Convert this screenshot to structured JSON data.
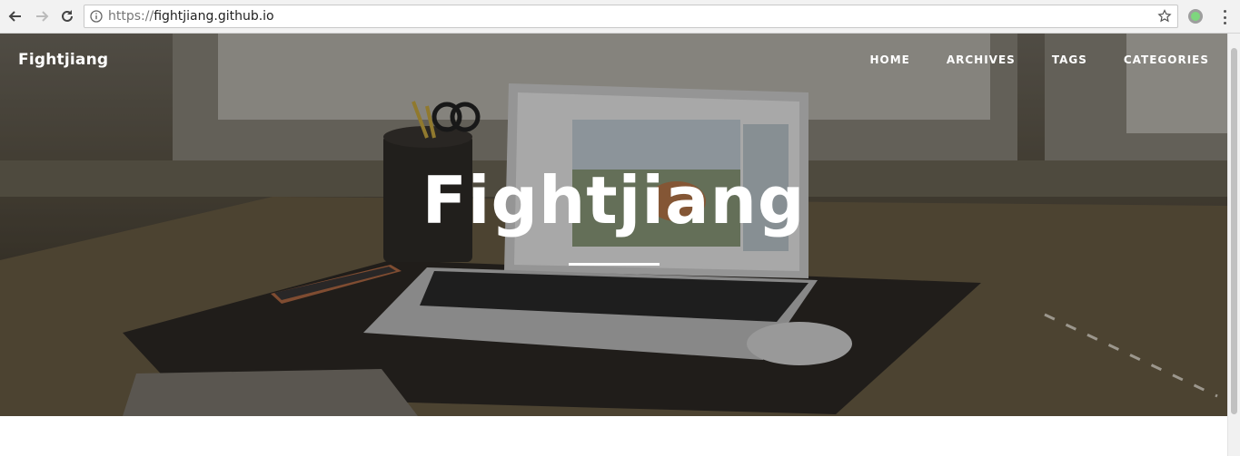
{
  "browser": {
    "url_scheme": "https://",
    "url_host": "fightjiang.github.io",
    "icons": {
      "back": "back-arrow-icon",
      "forward": "forward-arrow-icon",
      "reload": "reload-icon",
      "info": "info-icon",
      "star": "bookmark-star-icon",
      "extension": "extension-icon",
      "menu": "menu-dots-icon"
    }
  },
  "site": {
    "brand": "Fightjiang",
    "nav": [
      "HOME",
      "ARCHIVES",
      "TAGS",
      "CATEGORIES"
    ],
    "hero_title": "Fightjiang"
  },
  "colors": {
    "accent": "#ffffff",
    "extension_green": "#7ed67e"
  }
}
